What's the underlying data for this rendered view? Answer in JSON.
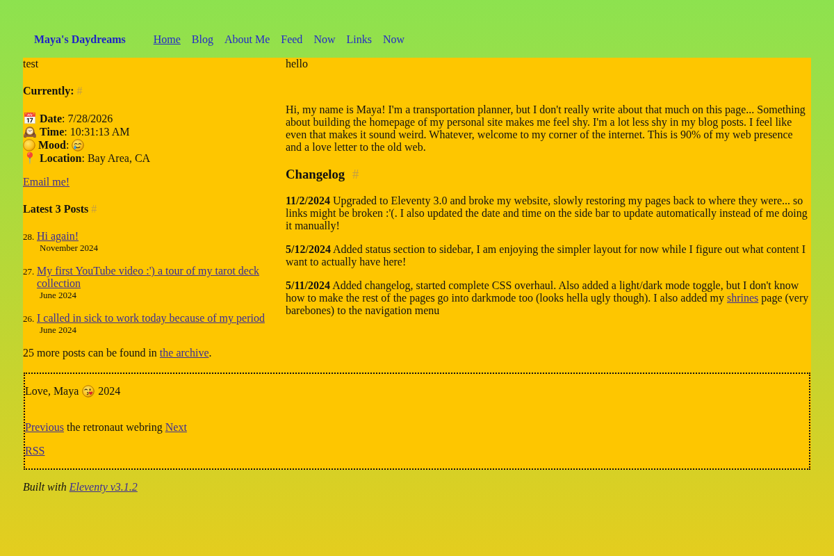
{
  "nav": {
    "brand": "Maya's Daydreams",
    "items": [
      {
        "label": "Home",
        "selected": true
      },
      {
        "label": "Blog",
        "selected": false
      },
      {
        "label": "About Me",
        "selected": false
      },
      {
        "label": "Feed",
        "selected": false
      },
      {
        "label": "Now",
        "selected": false
      },
      {
        "label": "Links",
        "selected": false
      },
      {
        "label": "Now",
        "selected": false
      }
    ]
  },
  "sidebar": {
    "intro": "test",
    "status_heading": {
      "label": "Currently:",
      "anchor": "#"
    },
    "status": [
      {
        "kind": "emoji",
        "icon": "📅",
        "text": "**Date**: 7/28/2026"
      },
      {
        "kind": "emoji",
        "icon": "🕰️",
        "text": "**Time**: 10:31:13 AM"
      },
      {
        "kind": "mood",
        "text": "**Mood**:"
      },
      {
        "kind": "emoji",
        "icon": "📍",
        "text": "**Location**: Bay Area, CA"
      }
    ],
    "email_link": "Email me!",
    "posts_heading": {
      "label": "Latest 3 Posts",
      "anchor": "#"
    },
    "posts": [
      {
        "number": "28.",
        "title": "Hi again!",
        "date": "November 2024"
      },
      {
        "number": "27.",
        "title": "My first YouTube video :') a tour of my tarot deck collection",
        "date": "June 2024"
      },
      {
        "number": "26.",
        "title": "I called in sick to work today because of my period",
        "date": "June 2024"
      }
    ],
    "archive_note": {
      "text": "25 more posts can be found in ",
      "link": "the archive",
      "text_after": "."
    }
  },
  "main": {
    "intro": "hello",
    "about": "Hi, my name is Maya! I'm a transportation planner, but I don't really write about that much on this page... Something about building the homepage of my personal site makes me feel shy. I'm a lot less shy in my blog posts. I feel like even that makes it sound weird. Whatever, welcome to my corner of the internet. This is 90% of my web presence and a love letter to the old web.",
    "changelog_heading": {
      "label": "Changelog",
      "anchor": "#"
    },
    "changelog": [
      {
        "text": "**11/2/2024** Upgraded to Eleventy 3.0 and broke my website, slowly restoring my pages back to where they were... so links might be broken :'(. I also updated the date and time on the side bar to update automatically instead of me doing it manually!"
      },
      {
        "text": "**5/12/2024** Added status section to sidebar, I am enjoying the simpler layout for now while I figure out what content I want to actually have here!"
      },
      {
        "text": "**5/11/2024** Added changelog, started complete CSS overhaul. Also added a light/dark mode toggle, but I don't know how to make the rest of the pages go into darkmode too (looks hella ugly though). I also added my ",
        "link": "shrines",
        "text_after": " page (very barebones) to the navigation menu"
      }
    ]
  },
  "footer": {
    "signoff": {
      "text": "Love, Maya",
      "year": "2024"
    },
    "webring": {
      "previous": "Previous",
      "text": "the retronaut webring",
      "next": "Next"
    },
    "rss": "RSS"
  },
  "built_with": {
    "text": "Built with",
    "link": "Eleventy v3.1.2"
  }
}
